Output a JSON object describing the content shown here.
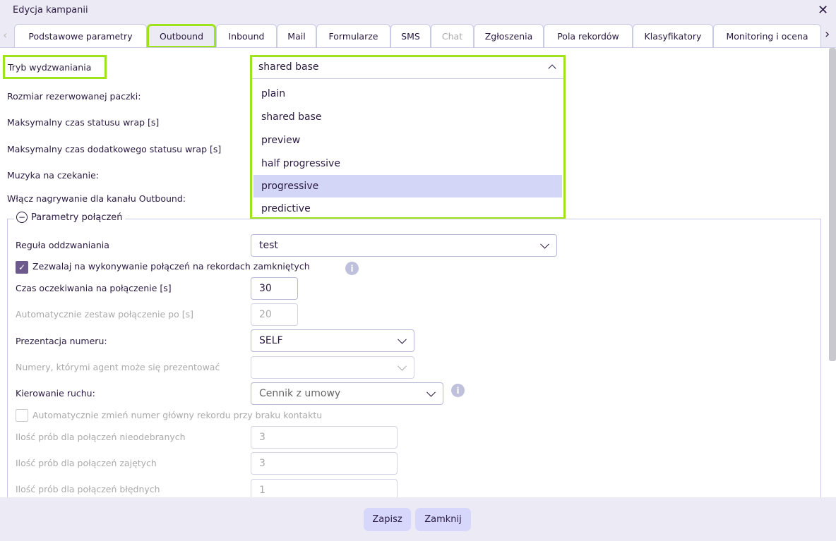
{
  "window": {
    "title": "Edycja kampanii",
    "close_icon": "close-icon"
  },
  "tabs": [
    {
      "label": "Podstawowe parametry"
    },
    {
      "label": "Outbound",
      "active": true
    },
    {
      "label": "Inbound"
    },
    {
      "label": "Mail"
    },
    {
      "label": "Formularze"
    },
    {
      "label": "SMS"
    },
    {
      "label": "Chat",
      "disabled": true
    },
    {
      "label": "Zgłoszenia"
    },
    {
      "label": "Pola rekordów"
    },
    {
      "label": "Klasyfikatory"
    },
    {
      "label": "Monitoring i ocena"
    }
  ],
  "form": {
    "dial_mode": {
      "label": "Tryb wydzwaniania",
      "value": "shared base",
      "options": [
        "plain",
        "shared base",
        "preview",
        "half progressive",
        "progressive",
        "predictive"
      ],
      "hovered": "progressive"
    },
    "labels": [
      "Rozmiar rezerwowanej paczki:",
      "Maksymalny czas statusu wrap [s]",
      "Maksymalny czas dodatkowego statusu wrap [s]",
      "Muzyka na czekanie:",
      "Włącz nagrywanie dla kanału Outbound:"
    ]
  },
  "connections": {
    "legend": "Parametry połączeń",
    "callback_rule": {
      "label": "Reguła oddzwaniania",
      "value": "test"
    },
    "allow_closed": {
      "label": "Zezwalaj na wykonywanie połączeń na rekordach zamkniętych",
      "checked": true
    },
    "wait_time": {
      "label": "Czas oczekiwania na połączenie [s]",
      "value": "30"
    },
    "auto_connect": {
      "label": "Automatycznie zestaw połączenie po [s]",
      "value": "20"
    },
    "number_presentation": {
      "label": "Prezentacja numeru:",
      "value": "SELF"
    },
    "agent_numbers": {
      "label": "Numery, którymi agent może się prezentować",
      "value": ""
    },
    "routing": {
      "label": "Kierowanie ruchu:",
      "value": "Cennik z umowy"
    },
    "auto_change": {
      "label": "Automatycznie zmień numer główny rekordu przy braku kontaktu",
      "checked": false
    },
    "no_answer": {
      "label": "Ilość prób dla połączeń nieodebranych",
      "value": "3"
    },
    "busy": {
      "label": "Ilość prób dla połączeń zajętych",
      "value": "3"
    },
    "failed": {
      "label": "Ilość prób dla połączeń błędnych",
      "value": "1"
    }
  },
  "footer": {
    "save": "Zapisz",
    "close": "Zamknij"
  },
  "colors": {
    "highlight": "#9fe31d",
    "accent": "#6c5a8c",
    "button": "#d6d7fb",
    "selected_option": "#d4d6f7"
  }
}
